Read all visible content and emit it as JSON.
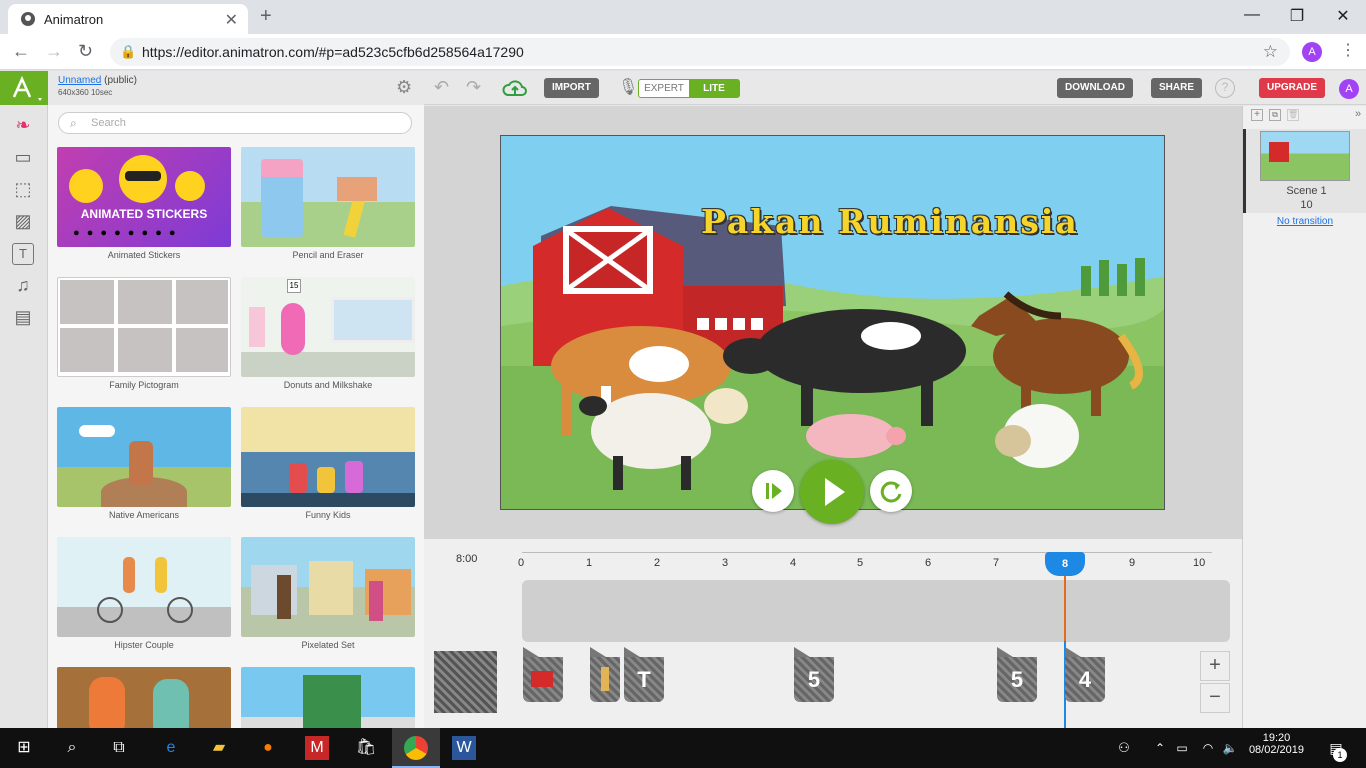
{
  "browser": {
    "tab_title": "Animatron",
    "url": "https://editor.animatron.com/#p=ad523c5cfb6d258564a17290",
    "profile_initial": "A"
  },
  "project": {
    "name": "Unnamed",
    "visibility": "(public)",
    "dims": "640x360",
    "duration": "10sec"
  },
  "toolbar": {
    "import": "IMPORT",
    "expert": "EXPERT",
    "lite": "LITE",
    "download": "DOWNLOAD",
    "share": "SHARE",
    "upgrade": "UPGRADE",
    "profile_initial": "A"
  },
  "library": {
    "search_placeholder": "Search",
    "items": [
      {
        "label": "Animated Stickers",
        "banner": "ANIMATED STICKERS"
      },
      {
        "label": "Pencil and Eraser"
      },
      {
        "label": "Family Pictogram"
      },
      {
        "label": "Donuts and Milkshake",
        "calendar_day": "15"
      },
      {
        "label": "Native Americans"
      },
      {
        "label": "Funny Kids"
      },
      {
        "label": "Hipster Couple"
      },
      {
        "label": "Pixelated Set"
      }
    ]
  },
  "stage": {
    "title": "Pakan Ruminansia"
  },
  "scenes": {
    "scene_name": "Scene 1",
    "scene_duration": "10",
    "transition": "No transition"
  },
  "timeline": {
    "time": "8:00",
    "ticks": [
      "0",
      "1",
      "2",
      "3",
      "4",
      "5",
      "6",
      "7",
      "8",
      "9",
      "10"
    ],
    "playhead": "8",
    "zoom_in": "+",
    "zoom_out": "−",
    "keyframes": [
      "",
      "",
      "T",
      "5",
      "5",
      "4"
    ]
  },
  "taskbar": {
    "time": "19:20",
    "date": "08/02/2019",
    "notif_count": "1"
  },
  "colors": {
    "brand_green": "#6ab023",
    "upgrade_red": "#e03a4a",
    "playhead_blue": "#1e88e5"
  }
}
